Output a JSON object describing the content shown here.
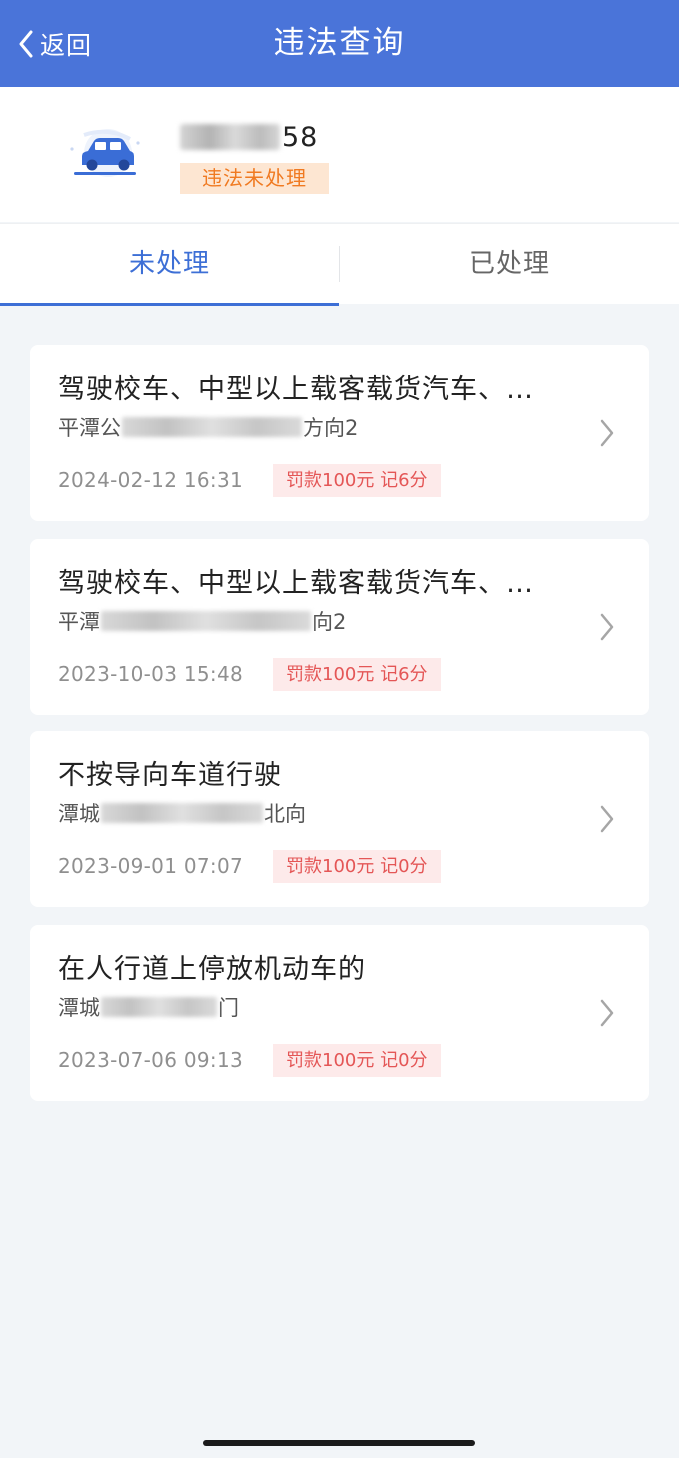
{
  "nav": {
    "back_label": "返回",
    "title": "违法查询"
  },
  "vehicle": {
    "plate_visible_suffix": "58",
    "status": "违法未处理",
    "icon": "car-icon"
  },
  "tabs": [
    {
      "label": "未处理",
      "active": true
    },
    {
      "label": "已处理",
      "active": false
    }
  ],
  "violations": [
    {
      "title": "驾驶校车、中型以上载客载货汽车、…",
      "location_prefix": "平潭公",
      "location_suffix": "方向2",
      "time": "2024-02-12 16:31",
      "penalty": "罚款100元 记6分"
    },
    {
      "title": "驾驶校车、中型以上载客载货汽车、…",
      "location_prefix": "平潭",
      "location_suffix": "向2",
      "time": "2023-10-03 15:48",
      "penalty": "罚款100元 记6分"
    },
    {
      "title": "不按导向车道行驶",
      "location_prefix": "潭城",
      "location_suffix": "北向",
      "time": "2023-09-01 07:07",
      "penalty": "罚款100元 记0分"
    },
    {
      "title": "在人行道上停放机动车的",
      "location_prefix": "潭城",
      "location_suffix": "门",
      "time": "2023-07-06 09:13",
      "penalty": "罚款100元 记0分"
    }
  ],
  "colors": {
    "header": "#4a74d9",
    "tab_active": "#3d6fd6",
    "status_bg": "#fde6d2",
    "status_text": "#f07a21",
    "penalty_bg": "#fdeaea",
    "penalty_text": "#e45656",
    "page_bg": "#f2f5f8"
  }
}
